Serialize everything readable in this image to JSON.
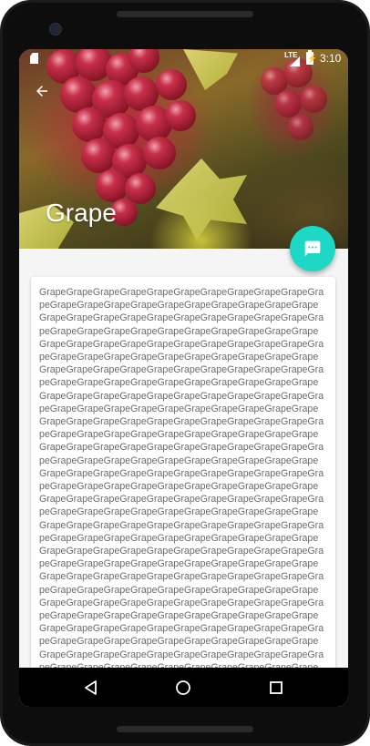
{
  "statusbar": {
    "network": "LTE",
    "time": "3:10",
    "sd_icon": "sd-card-icon",
    "signal_icon": "signal-icon",
    "battery_icon": "battery-charging-icon"
  },
  "header": {
    "title": "Grape",
    "back_icon": "arrow-back-icon",
    "hero_image": "grape-cluster-photo"
  },
  "fab": {
    "icon": "message-icon",
    "color": "#1ed8c6"
  },
  "content": {
    "body_text": "GrapeGrapeGrapeGrapeGrapeGrapeGrapeGrapeGrapeGrapeGrapeGrapeGrapeGrapeGrapeGrapeGrapeGrapeGrapeGrapeGrapeGrapeGrapeGrapeGrapeGrapeGrapeGrapeGrapeGrapeGrapeGrapeGrapeGrapeGrapeGrapeGrapeGrapeGrapeGrapeGrapeGrapeGrapeGrapeGrapeGrapeGrapeGrapeGrapeGrapeGrapeGrapeGrapeGrapeGrapeGrapeGrapeGrapeGrapeGrapeGrapeGrapeGrapeGrapeGrapeGrapeGrapeGrapeGrapeGrapeGrapeGrapeGrapeGrapeGrapeGrapeGrapeGrapeGrapeGrapeGrapeGrapeGrapeGrapeGrapeGrapeGrapeGrapeGrapeGrapeGrapeGrapeGrapeGrapeGrapeGrapeGrapeGrapeGrapeGrapeGrapeGrapeGrapeGrapeGrapeGrapeGrapeGrapeGrapeGrapeGrapeGrapeGrapeGrapeGrapeGrapeGrapeGrapeGrapeGrapeGrapeGrapeGrapeGrapeGrapeGrapeGrapeGrapeGrapeGrapeGrapeGrapeGrapeGrapeGrapeGrapeGrapeGrapeGrapeGrapeGrapeGrapeGrapeGrapeGrapeGrapeGrapeGrapeGrapeGrapeGrapeGrapeGrapeGrapeGrapeGrapeGrapeGrapeGrapeGrapeGrapeGrapeGrapeGrapeGrapeGrapeGrapeGrapeGrapeGrapeGrapeGrapeGrapeGrapeGrapeGrapeGrapeGrapeGrapeGrapeGrapeGrapeGrapeGrapeGrapeGrapeGrapeGrapeGrapeGrapeGrapeGrapeGrapeGrapeGrapeGrapeGrapeGrapeGrapeGrapeGrapeGrapeGrapeGrapeGrapeGrapeGrapeGrapeGrapeGrapeGrapeGrapeGrapeGrapeGrapeGrapeGrapeGrapeGrapeGrapeGrapeGrapeGrapeGrapeGrapeGrapeGrapeGrapeGrapeGrapeGrapeGrapeGrapeGrapeGrapeGrapeGrapeGrapeGrapeGrapeGrapeGrapeGrapeGrapeGrapeGrapeGrapeGrapeGrapeGrapeGrapeGrapeGrapeGrapeGrapeGrapeGrapeGrapeGrapeGrapeGrapeGrapeGrapeGrapeGrapeGrapeGrapeGrapeGrapeGrapeGrapeGrapeGrapeGrapeGrapeGrapeGrapeGrapeGrapeGrapeGrapeGrapeGrapeGrapeGrapeGrapeGrapeGrapeGrapeGrapeGrapeGrapeGrapeGrapeGrapeGrapeGrapeGrapeGrapeGrapeGrapeGrapeGrapeGrapeGrapeGrapeGrapeGrapeGrapeGrapeGrapeGrapeGrapeGrapeGrapeGrapeGrapeGrapeGrapeGrapeGrapeGrapeGrapeGrapeGrapeGrapeGrapeGrapeGrapeGrapeGrapeGrapeGrapeGrapeGrapeGrapeGrapeGrapeGrapeGrapeGrapeGrapeGrapeGrapeGrapeGrapeGrapeGrapeGrapeGrapeGrapeGrapeGrapeGrapeGrapeGrapeGrapeGrapeGrapeGrapeGrapeGrapeGrapeGrapeGrapeGrapeGrapeGrapeGrapeGrapeGrapeGrapeGrapeGrapeGrapeGrapeGrapeGrapeGrapeGrapeGrapeGrapeGrapeGrapeGrapeGrapeGrapeGrapeGrapeGrapeGrapeGrapeGrapeGrapeGrapeGrapeGrapeGrape"
  },
  "navbar": {
    "back_icon": "nav-back-icon",
    "home_icon": "nav-home-icon",
    "recents_icon": "nav-recents-icon"
  }
}
